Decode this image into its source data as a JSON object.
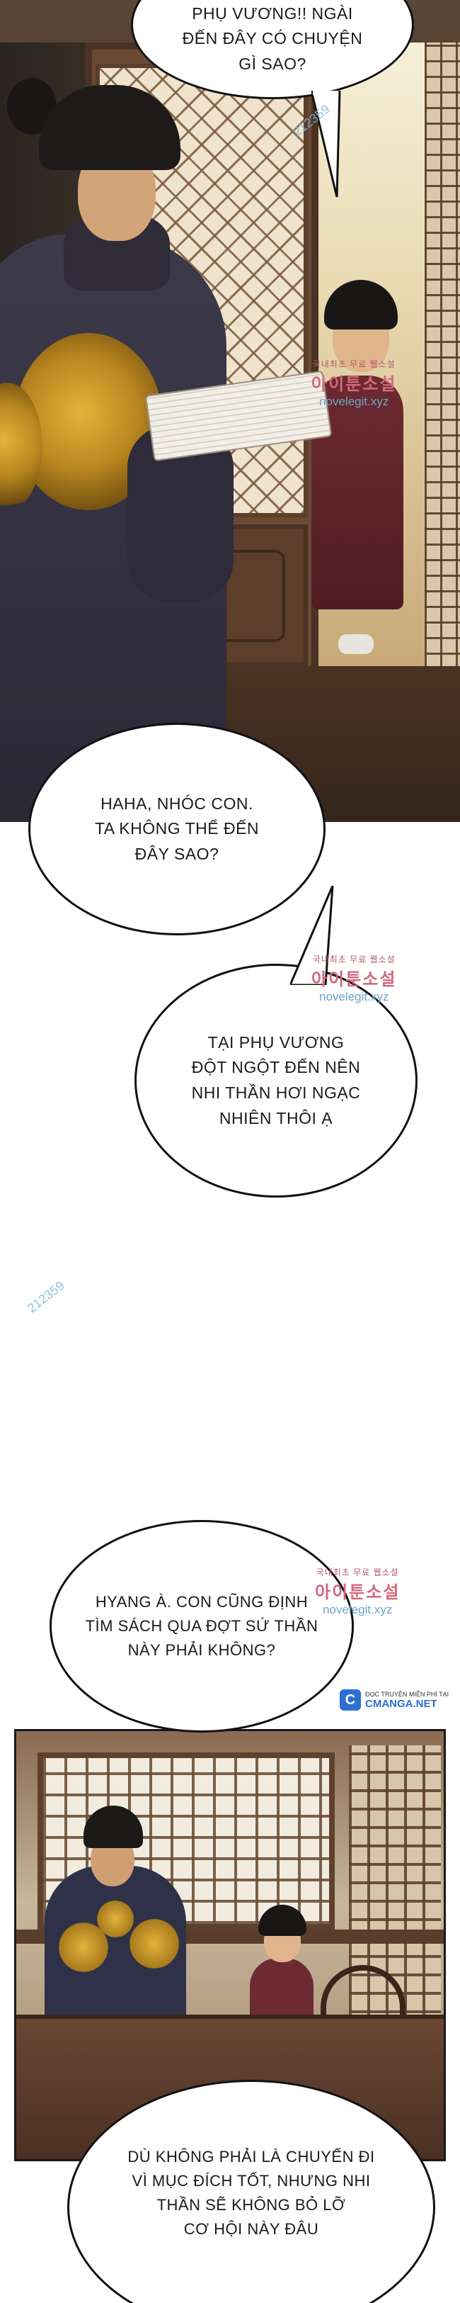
{
  "bubbles": {
    "b1": "PHỤ VƯƠNG!! NGÀI\nĐẾN ĐÂY CÓ CHUYỆN\nGÌ SAO?",
    "b2": "HAHA, NHÓC CON.\nTA KHÔNG THỂ ĐẾN\nĐÂY SAO?",
    "b3": "TẠI PHỤ VƯƠNG\nĐỘT NGỘT ĐẾN NÊN\nNHI THẦN HƠI NGẠC\nNHIÊN THÔI Ạ",
    "b4": "HYANG À. CON CŨNG ĐỊNH\nTÌM SÁCH QUA ĐỢT SỨ THẦN\nNÀY PHẢI KHÔNG?",
    "b5": "DÙ KHÔNG PHẢI LÀ CHUYẾN ĐI\nVÌ MỤC ĐÍCH TỐT, NHƯNG NHI\nTHẦN SẼ KHÔNG BỎ LỠ\nCƠ HỘI NÀY ĐÂU"
  },
  "watermarks": {
    "number": "212359",
    "site_top": "국내최초 무료 웹소설",
    "site_name": "아이툰소설",
    "site_url": "novelegit.xyz",
    "cmanga_small": "ĐỌC TRUYỆN MIỄN PHÍ TẠI",
    "cmanga_name": "CMANGA.NET",
    "cmanga_letter": "C"
  },
  "colors": {
    "accent_robe_king": "#2e3147",
    "accent_robe_child": "#6e2a33",
    "dragon_gold": "#e1b23b"
  }
}
